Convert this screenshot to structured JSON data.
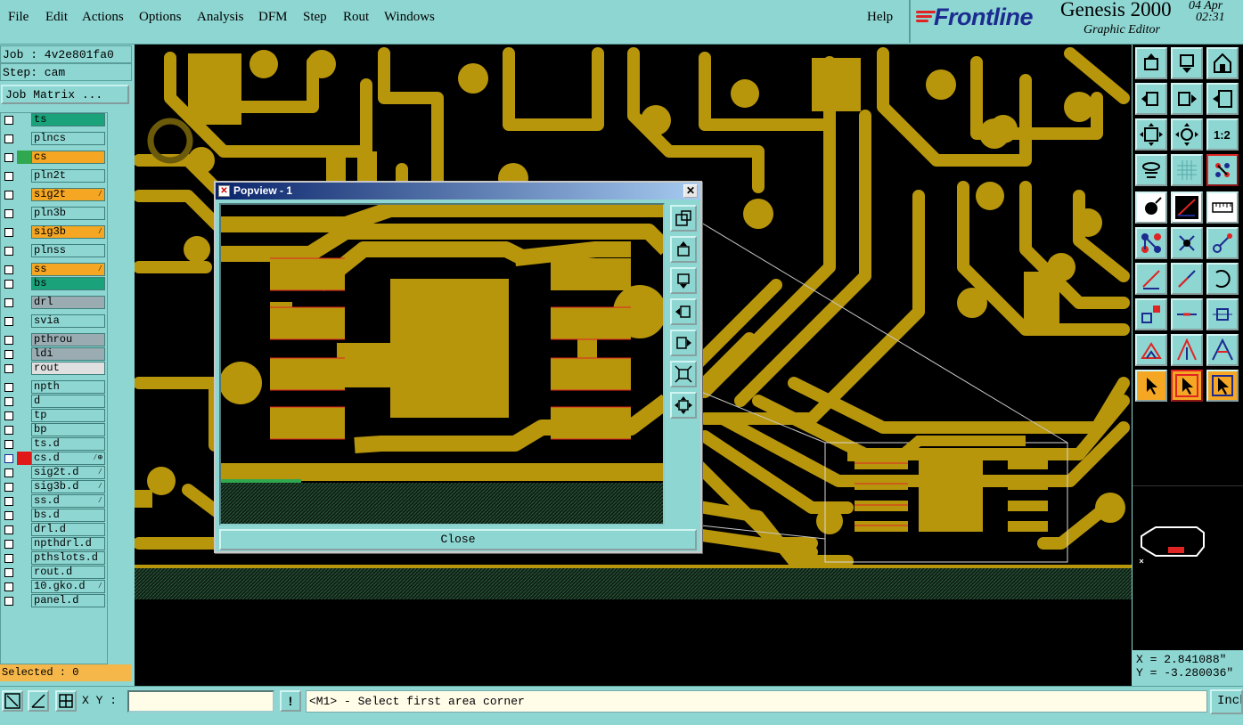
{
  "menu": {
    "items": [
      "File",
      "Edit",
      "Actions",
      "Options",
      "Analysis",
      "DFM",
      "Step",
      "Rout",
      "Windows"
    ],
    "help": "Help"
  },
  "brand": {
    "logo": "Frontline",
    "product": "Genesis 2000",
    "subtitle": "Graphic Editor",
    "date": "04 Apr",
    "time": "02:31"
  },
  "job": {
    "job_label": "Job : 4v2e801fa0",
    "step_label": "Step: cam",
    "matrix_button": "Job Matrix ..."
  },
  "layers": [
    {
      "name": "ts",
      "bg": "#1aa37a",
      "color": ""
    },
    {
      "name": "plncs",
      "bg": "#8ed6d2",
      "color": ""
    },
    {
      "name": "cs",
      "bg": "#f5a623",
      "color": "#2fa84f"
    },
    {
      "name": "pln2t",
      "bg": "#8ed6d2",
      "color": ""
    },
    {
      "name": "sig2t",
      "bg": "#f5a623",
      "color": "",
      "mark": "⁄"
    },
    {
      "name": "pln3b",
      "bg": "#8ed6d2",
      "color": ""
    },
    {
      "name": "sig3b",
      "bg": "#f5a623",
      "color": "",
      "mark": "⁄"
    },
    {
      "name": "plnss",
      "bg": "#8ed6d2",
      "color": ""
    },
    {
      "name": "ss",
      "bg": "#f5a623",
      "color": "",
      "mark": "⁄"
    },
    {
      "name": "bs",
      "bg": "#1aa37a",
      "color": ""
    },
    {
      "name": "drl",
      "bg": "#9aacb2",
      "color": ""
    },
    {
      "name": "svia",
      "bg": "#8ed6d2",
      "color": ""
    },
    {
      "name": "pthrou",
      "bg": "#9aacb2",
      "color": ""
    },
    {
      "name": "ldi",
      "bg": "#9aacb2",
      "color": ""
    },
    {
      "name": "rout",
      "bg": "#e0e0e0",
      "color": ""
    },
    {
      "name": "npth",
      "bg": "#8ed6d2",
      "color": ""
    },
    {
      "name": "d",
      "bg": "#8ed6d2",
      "color": ""
    },
    {
      "name": "tp",
      "bg": "#8ed6d2",
      "color": ""
    },
    {
      "name": "bp",
      "bg": "#8ed6d2",
      "color": ""
    },
    {
      "name": "ts.d",
      "bg": "#8ed6d2",
      "color": ""
    },
    {
      "name": "cs.d",
      "bg": "#8ed6d2",
      "color": "#e01818",
      "mark": "⁄⊕"
    },
    {
      "name": "sig2t.d",
      "bg": "#8ed6d2",
      "color": "",
      "mark": "⁄"
    },
    {
      "name": "sig3b.d",
      "bg": "#8ed6d2",
      "color": "",
      "mark": "⁄"
    },
    {
      "name": "ss.d",
      "bg": "#8ed6d2",
      "color": "",
      "mark": "⁄"
    },
    {
      "name": "bs.d",
      "bg": "#8ed6d2",
      "color": ""
    },
    {
      "name": "drl.d",
      "bg": "#8ed6d2",
      "color": ""
    },
    {
      "name": "npthdrl.d",
      "bg": "#8ed6d2",
      "color": ""
    },
    {
      "name": "pthslots.d",
      "bg": "#8ed6d2",
      "color": ""
    },
    {
      "name": "rout.d",
      "bg": "#8ed6d2",
      "color": ""
    },
    {
      "name": "10.gko.d",
      "bg": "#8ed6d2",
      "color": "",
      "mark": "⁄"
    },
    {
      "name": "panel.d",
      "bg": "#8ed6d2",
      "color": ""
    }
  ],
  "selected": "Selected : 0",
  "coords": {
    "x": "X = 2.841088\"",
    "y": "Y = -3.280036\""
  },
  "statusbar": {
    "xy_label": "X Y :",
    "xy_value": "",
    "exclaim": "!",
    "prompt": "<M1> - Select first area corner",
    "units": "Inch"
  },
  "popview": {
    "title": "Popview - 1",
    "close_label": "Close"
  },
  "colors": {
    "copper": "#b8960c",
    "board_bg": "#000000",
    "ui_bg": "#8ed6d2",
    "active_tool": "#f5a623",
    "hatch": "#1f3a2a"
  }
}
